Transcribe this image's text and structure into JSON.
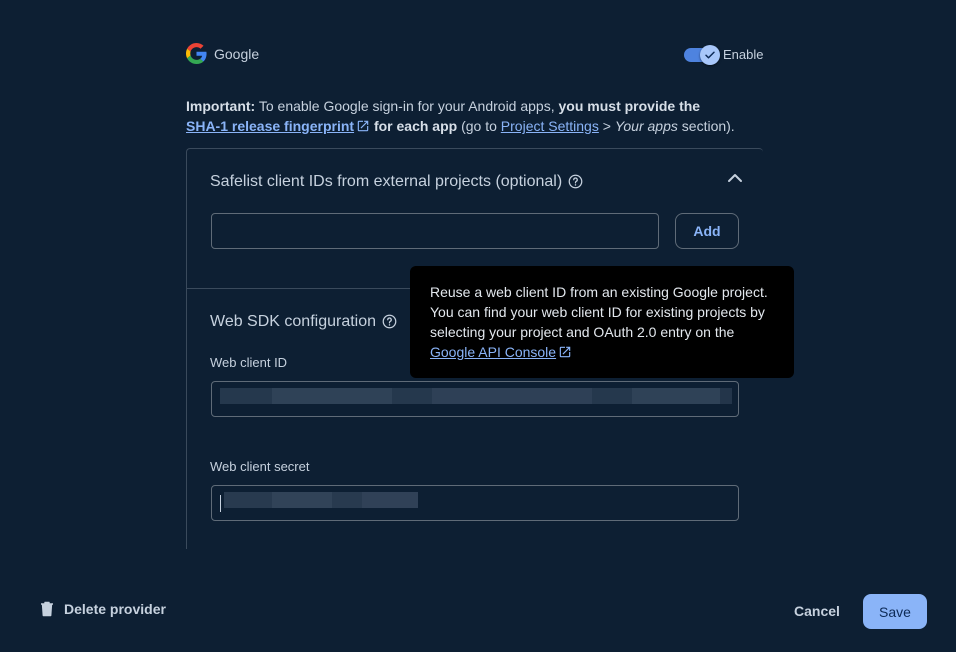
{
  "header": {
    "provider_name": "Google",
    "enable_label": "Enable",
    "enabled": true
  },
  "notice": {
    "important": "Important:",
    "text1": " To enable Google sign-in for your Android apps, ",
    "bold1": "you must provide the",
    "link_sha": "SHA-1 release fingerprint",
    "bold2": " for each app",
    "text2": " (go to ",
    "link_settings": "Project Settings",
    "text3": " > ",
    "italic": "Your apps",
    "text4": " section)."
  },
  "safelist": {
    "title": "Safelist client IDs from external projects (optional)",
    "input_value": "",
    "add_label": "Add"
  },
  "web_sdk": {
    "title": "Web SDK configuration",
    "client_id_label": "Web client ID",
    "client_secret_label": "Web client secret"
  },
  "tooltip": {
    "line1": "Reuse a web client ID from an existing Google project.",
    "line2": "You can find your web client ID for existing projects by",
    "line3": "selecting your project and OAuth 2.0 entry on the",
    "link": "Google API Console"
  },
  "footer": {
    "delete_label": "Delete provider",
    "cancel_label": "Cancel",
    "save_label": "Save"
  },
  "colors": {
    "background": "#0d1f33",
    "accent": "#8ab4f8",
    "toggle_track": "#4e83df"
  }
}
